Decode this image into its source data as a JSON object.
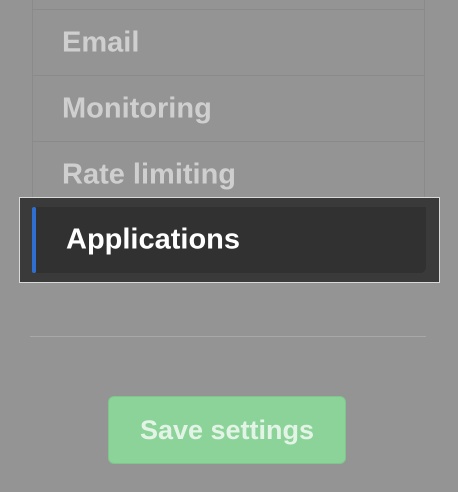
{
  "sidebar": {
    "items": [
      {
        "label": "Email"
      },
      {
        "label": "Monitoring"
      },
      {
        "label": "Rate limiting"
      }
    ],
    "selected": {
      "label": "Applications"
    }
  },
  "actions": {
    "save_label": "Save settings"
  },
  "colors": {
    "accent": "#2f6fcf",
    "save_button_bg": "#8cd39a",
    "overlay_bg": "#949494"
  }
}
